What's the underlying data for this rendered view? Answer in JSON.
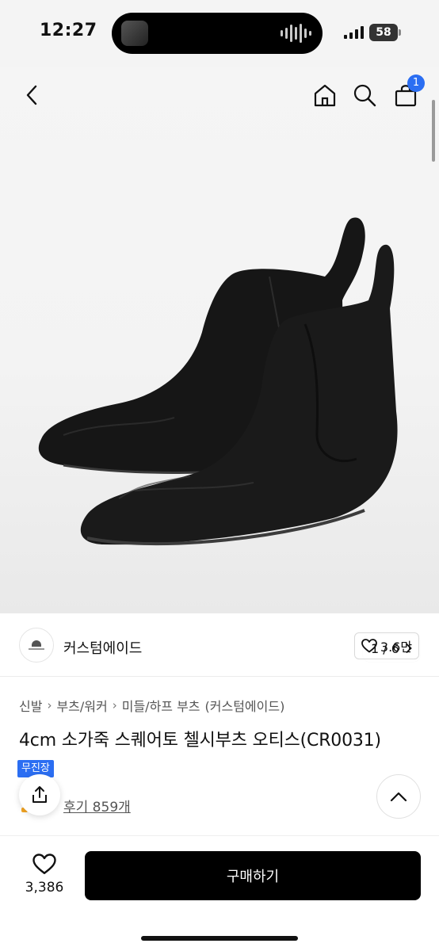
{
  "status": {
    "time": "12:27",
    "battery": "58"
  },
  "gallery": {
    "page_current": "1",
    "page_total": "6",
    "page_sep": " / ",
    "image_alt": "black leather chelsea boots"
  },
  "header": {
    "cart_count": "1"
  },
  "brand": {
    "name": "커스텀에이드",
    "likes": "3.6만"
  },
  "breadcrumb": [
    "신발",
    "부츠/워커",
    "미들/하프 부츠",
    "(커스텀에이드)"
  ],
  "product": {
    "title": "4cm 소가죽 스퀘어토 첼시부츠 오티스(CR0031)",
    "tag": "무진장",
    "reviews": "후기 859개"
  },
  "bottom": {
    "wish_count": "3,386",
    "buy_label": "구매하기"
  },
  "colors": {
    "accent": "#2b6ef2",
    "buy_button": "#000000"
  }
}
